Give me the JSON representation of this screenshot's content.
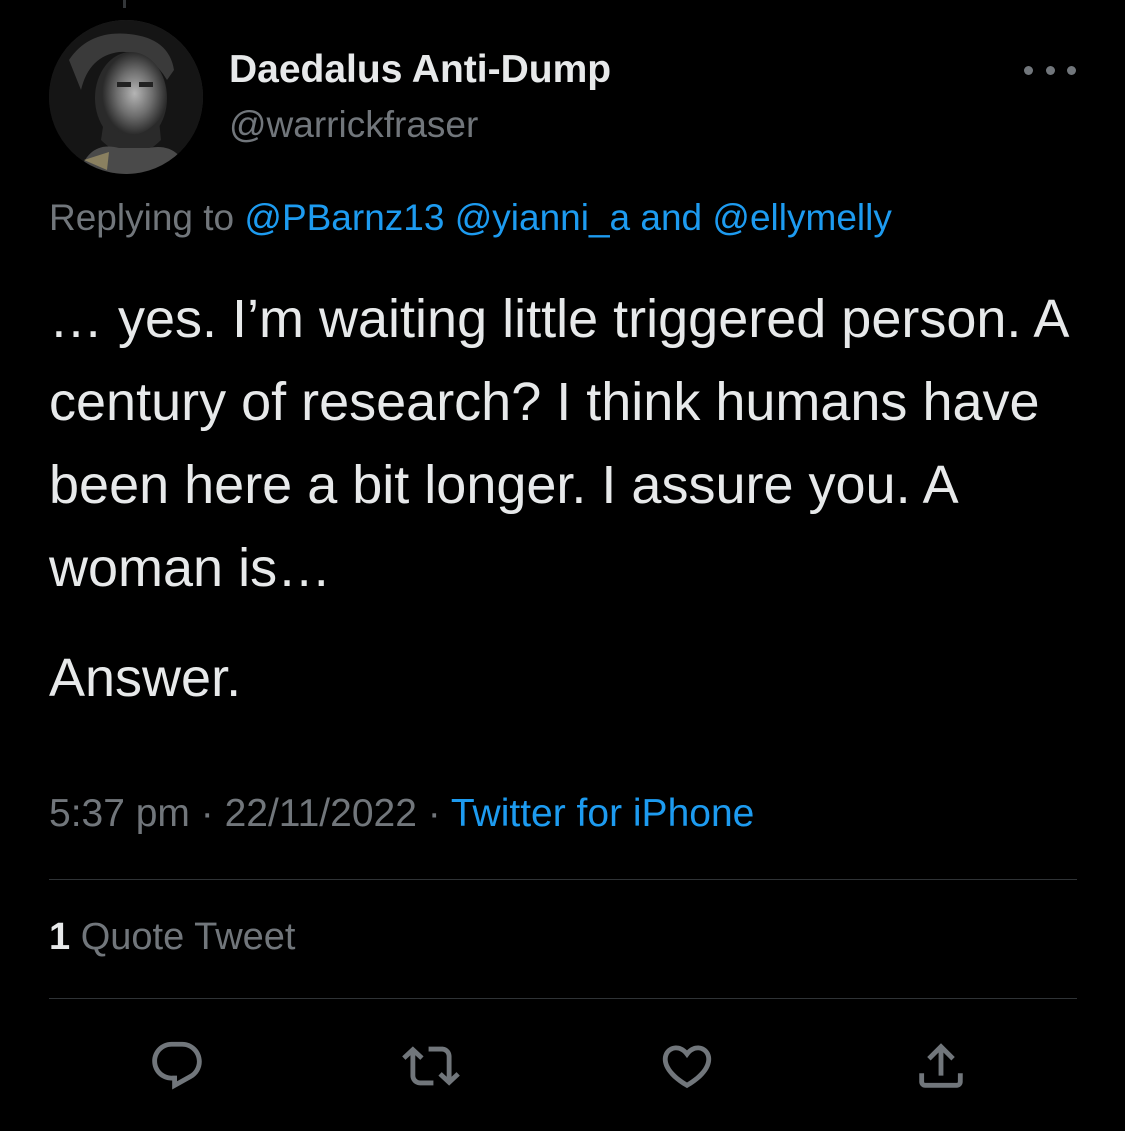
{
  "author": {
    "display_name": "Daedalus Anti-Dump",
    "handle": "@warrickfraser"
  },
  "reply_context": {
    "prefix": "Replying to ",
    "mention_1": "@PBarnz13",
    "mention_2": "@yianni_a",
    "conjunction": " and ",
    "mention_3": "@ellymelly"
  },
  "tweet": {
    "paragraph_1": "… yes. I’m waiting little triggered person. A century of research? I think humans have been here a bit longer. I assure you. A woman is…",
    "paragraph_2": "Answer."
  },
  "meta": {
    "time": "5:37 pm",
    "separator": " · ",
    "date": "22/11/2022",
    "source": "Twitter for iPhone"
  },
  "stats": {
    "quote_count": "1",
    "quote_label": " Quote Tweet"
  },
  "icons": {
    "more": "more-horizontal-icon",
    "reply": "reply-bubble-icon",
    "retweet": "retweet-icon",
    "like": "heart-icon",
    "share": "share-upload-icon"
  },
  "colors": {
    "background": "#000000",
    "primary_text": "#e7e9ea",
    "secondary_text": "#71767b",
    "link": "#1d9bf0",
    "divider": "#2f3336"
  }
}
